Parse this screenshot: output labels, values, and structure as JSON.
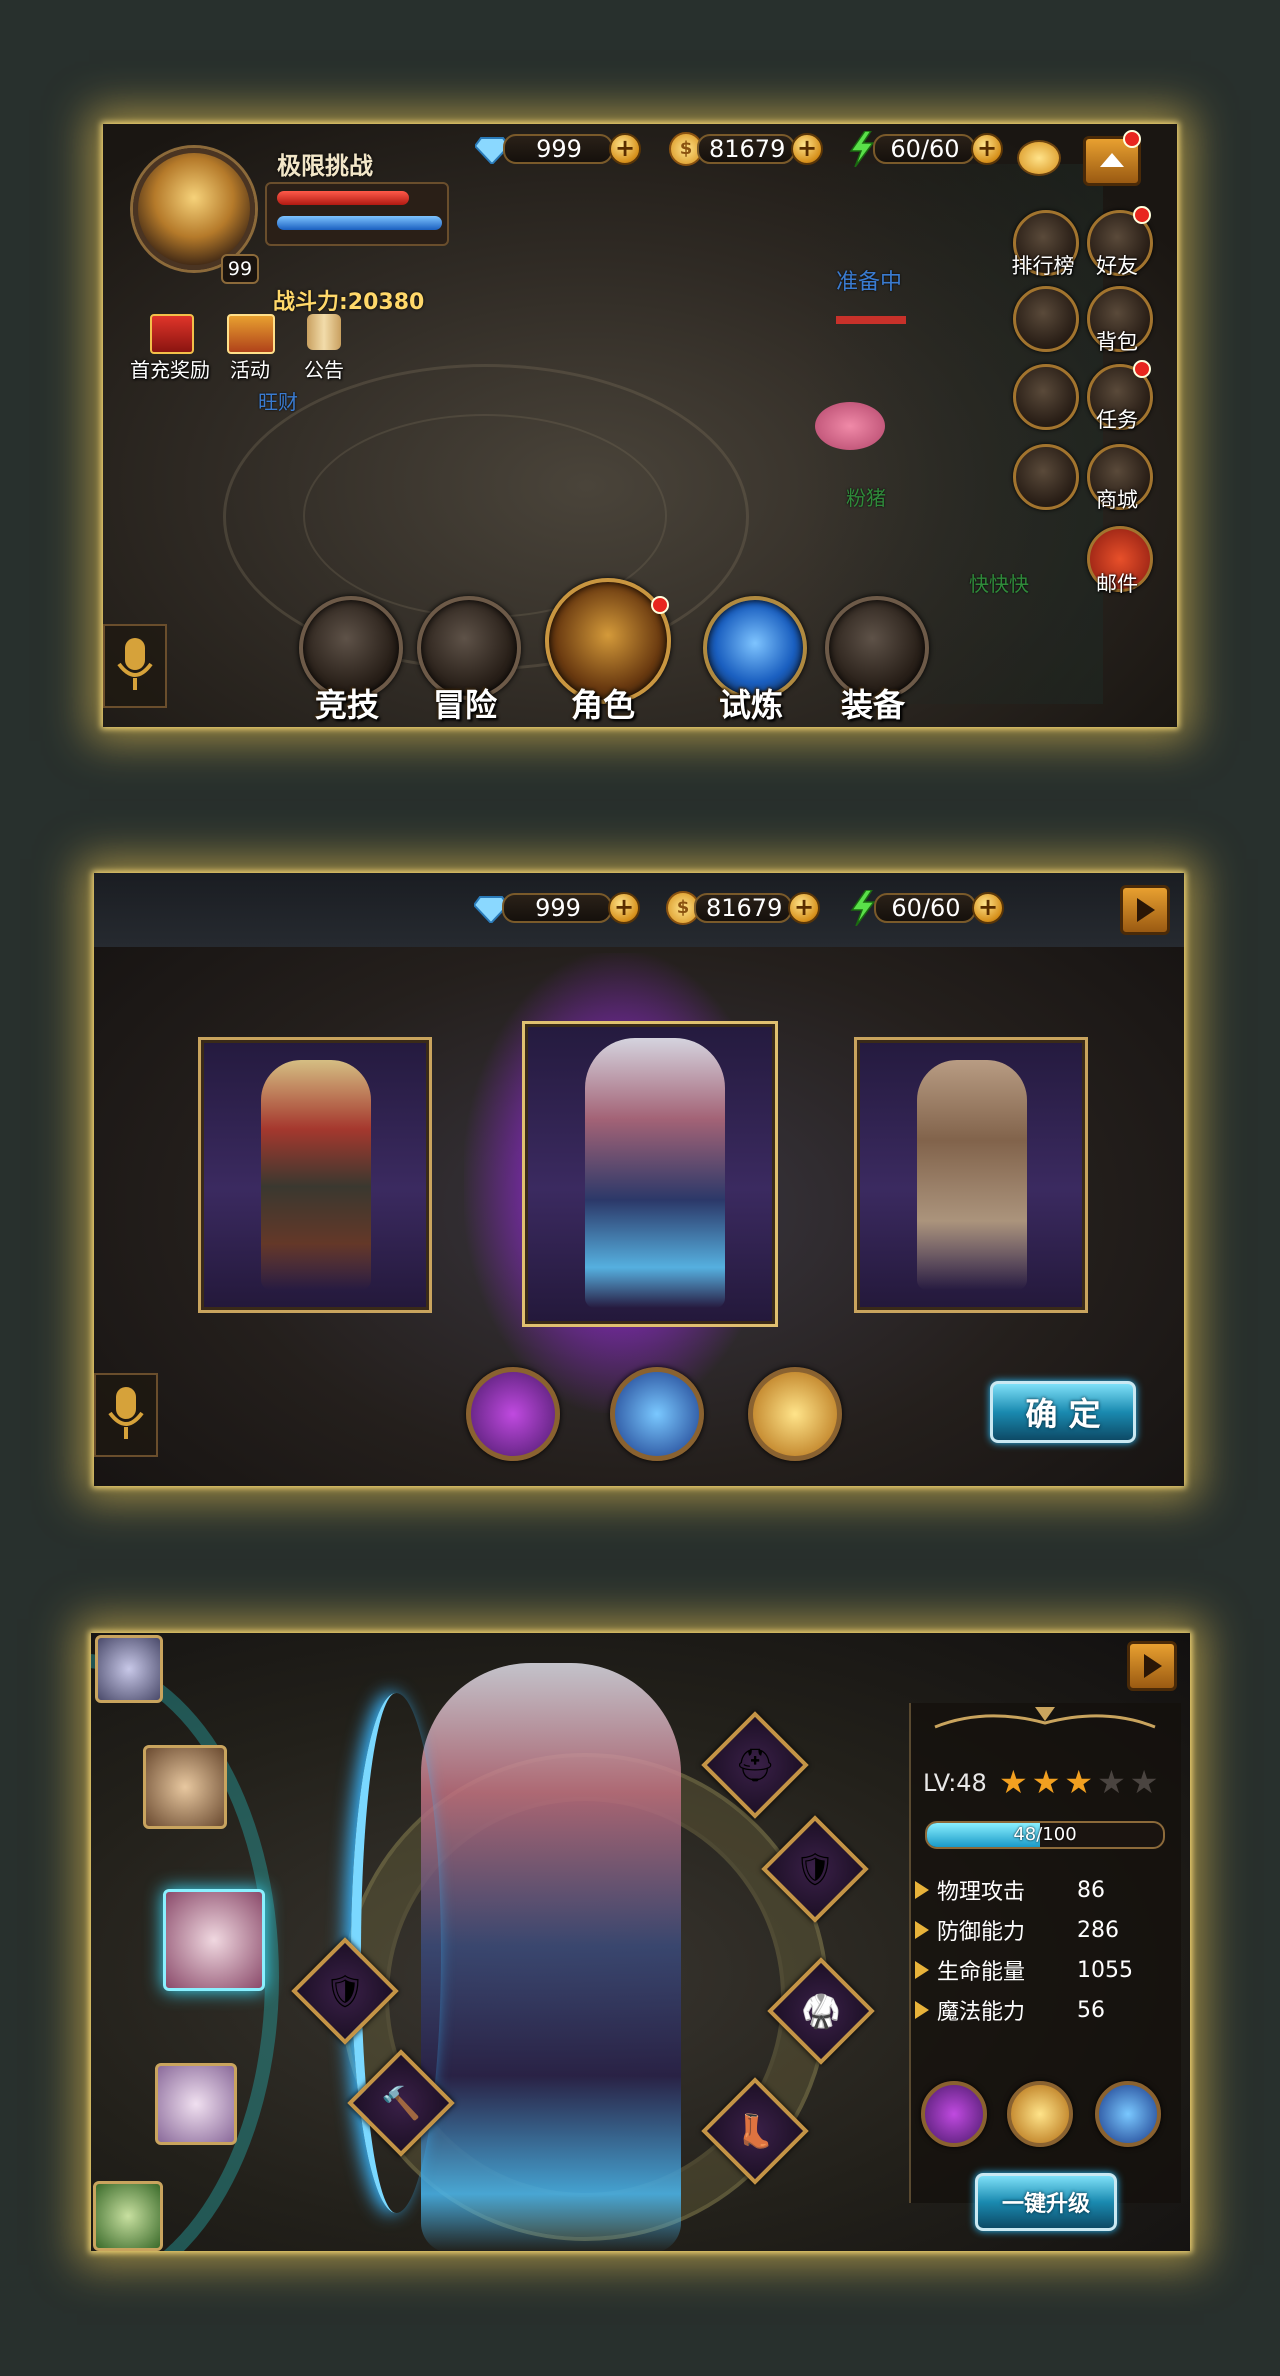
{
  "resources": {
    "diamonds": "999",
    "gold": "81679",
    "stamina": "60/60"
  },
  "screen1": {
    "title": "极限挑战",
    "level": "99",
    "combat_power": "战斗力:20380",
    "top_left_menu": [
      "首充奖励",
      "活动",
      "公告"
    ],
    "side_menu": [
      "排行榜",
      "好友",
      "背包",
      "任务",
      "商城",
      "邮件"
    ],
    "scene_texts": [
      "准备中",
      "旺财",
      "粉猪",
      "快快快"
    ],
    "bottom_nav": [
      "竞技",
      "冒险",
      "角色",
      "试炼",
      "装备"
    ]
  },
  "screen2": {
    "confirm_label": "确 定"
  },
  "screen3": {
    "level_label": "LV:48",
    "stars_filled": 3,
    "stars_total": 5,
    "exp_text": "48/100",
    "exp_fraction": 0.48,
    "stats": [
      {
        "name": "物理攻击",
        "value": "86"
      },
      {
        "name": "防御能力",
        "value": "286"
      },
      {
        "name": "生命能量",
        "value": "1055"
      },
      {
        "name": "魔法能力",
        "value": "56"
      }
    ],
    "upgrade_label": "一键升级"
  },
  "colors": {
    "accent_gold": "#d6901b",
    "glow": "#ffd65a",
    "purple": "#8a3bd0"
  }
}
